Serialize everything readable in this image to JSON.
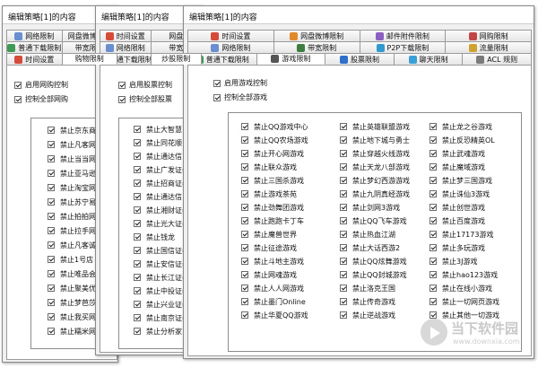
{
  "colors": {
    "tab_icon": "#2e6fc9",
    "window_bg": "#f0f0f0",
    "panel_bg": "#ffffff"
  },
  "win1": {
    "title": "编辑策略[1]的内容",
    "tabs_row1": [
      "网络限制",
      "网盘微博限制"
    ],
    "tabs_row2": [
      "普通下载限制",
      "带宽限制"
    ],
    "tabs_row3": [
      "时间设置",
      "购物限制"
    ],
    "enable_label": "启用网购控制",
    "all_label": "控制全部网购",
    "items": [
      "禁止京东商城",
      "禁止凡客网购",
      "禁止当当网",
      "禁止亚马逊",
      "禁止淘宝网",
      "禁止苏宁易购",
      "禁止拍拍网",
      "禁止拉手网",
      "禁止凡客诚品",
      "禁止1号店",
      "禁止唯品会",
      "禁止聚美优品",
      "禁止梦芭莎",
      "禁止我买网",
      "禁止糯米网"
    ]
  },
  "win2": {
    "title": "编辑策略[1]的内容",
    "tabs_row1": [
      "时间设置",
      "网盘"
    ],
    "tabs_row2": [
      "网络限制",
      "带宽"
    ],
    "tabs_row3": [
      "普通下载限制",
      "炒股限制"
    ],
    "enable_label": "启用股票控制",
    "all_label": "控制全部股票",
    "items": [
      "禁止大智慧",
      "禁止同花顺",
      "禁止通达信",
      "禁止广发证券",
      "禁止招商证券",
      "禁止通达信",
      "禁止湘财证券",
      "禁止光大证券",
      "禁止钱龙",
      "禁止国信证券",
      "禁止安信证券",
      "禁止长江证券",
      "禁止中投证券",
      "禁止兴业证券",
      "禁止南京证券",
      "禁止分析家"
    ]
  },
  "win3": {
    "title": "编辑策略[1]的内容",
    "tabs_row1": [
      "时间设置",
      "网盘微博限制",
      "邮件附件限制",
      "网购限制"
    ],
    "tabs_row2": [
      "网络限制",
      "带宽限制",
      "P2P下载限制",
      "流量限制"
    ],
    "tabs_row3": [
      "普通下载限制",
      "游戏限制",
      "股票限制",
      "聊天限制",
      "ACL 规则"
    ],
    "enable_label": "启用游戏控制",
    "all_label": "控制全部游戏",
    "col1": [
      "禁止QQ游戏中心",
      "禁止QQ农场游戏",
      "禁止开心网游戏",
      "禁止联众游戏",
      "禁止三国杀游戏",
      "禁止游戏茶苑",
      "禁止劲舞团游戏",
      "禁止跑跑卡丁车",
      "禁止魔兽世界",
      "禁止征途游戏",
      "禁止斗地主游戏",
      "禁止网魂游戏",
      "禁止人人网游戏",
      "禁止墨门Online",
      "禁止华夏QQ游戏"
    ],
    "col2": [
      "禁止英雄联盟游戏",
      "禁止地下城与勇士",
      "禁止穿越火线游戏",
      "禁止天龙八部游戏",
      "禁止梦幻西游游戏",
      "禁止九阴真经游戏",
      "禁止剑网3游戏",
      "禁止QQ飞车游戏",
      "禁止热血江湖",
      "禁止大话西游2",
      "禁止QQ炫舞游戏",
      "禁止QQ封城游戏",
      "禁止洛克王国",
      "禁止传奇游戏",
      "禁止逆战游戏"
    ],
    "col3": [
      "禁止龙之谷游戏",
      "禁止反恐精英OL",
      "禁止武魂游戏",
      "禁止魔域游戏",
      "禁止梦三国游戏",
      "禁止诛仙3游戏",
      "禁止创世游戏",
      "禁止百度游戏",
      "禁止17173游戏",
      "禁止多玩游戏",
      "禁止3J游戏",
      "禁止hao123游戏",
      "禁止在线小游戏",
      "禁止一切网页游戏",
      "禁止其他一切游戏"
    ]
  },
  "watermark": {
    "name": "当下软件园",
    "url": "www.downxia.com"
  }
}
